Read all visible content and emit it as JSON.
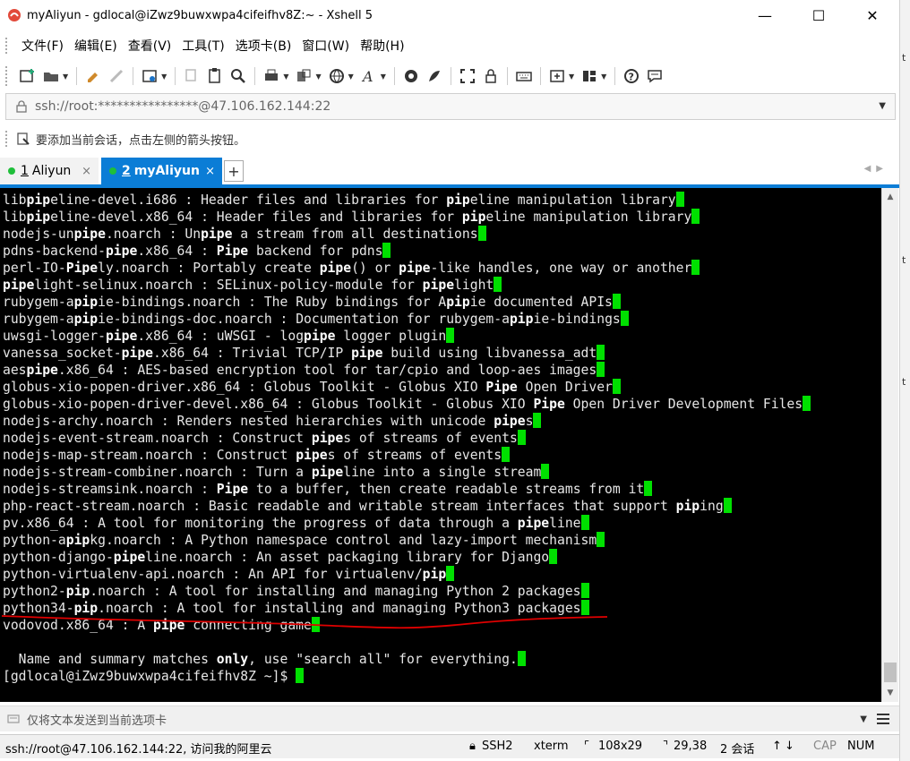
{
  "window": {
    "title": "myAliyun - gdlocal@iZwz9buwxwpa4cifeifhv8Z:~ - Xshell 5",
    "minimize": "—",
    "maximize": "☐",
    "close": "✕"
  },
  "menu": [
    "文件(F)",
    "编辑(E)",
    "查看(V)",
    "工具(T)",
    "选项卡(B)",
    "窗口(W)",
    "帮助(H)"
  ],
  "address": {
    "value": "ssh://root:****************@47.106.162.144:22"
  },
  "hint": {
    "text": "要添加当前会话，点击左侧的箭头按钮。"
  },
  "tabs": [
    {
      "num": "1",
      "label": "Aliyun",
      "close": "×",
      "active": false
    },
    {
      "num": "2",
      "label": "myAliyun",
      "close": "×",
      "active": true
    }
  ],
  "tab_add": "+",
  "terminal": {
    "lines": [
      [
        [
          "libpipeline-devel.i686 : Header files and libraries for ",
          ""
        ]
      ],
      [
        [
          "lib",
          ""
        ],
        [
          "pip",
          "b"
        ],
        [
          "eline-devel.i686 : Header files and libraries for ",
          ""
        ],
        [
          "pip",
          "b"
        ],
        [
          "eline manipulation library",
          ""
        ]
      ],
      [
        [
          "lib",
          ""
        ],
        [
          "pip",
          "b"
        ],
        [
          "eline-devel.x86_64 : Header files and libraries for ",
          ""
        ],
        [
          "pip",
          "b"
        ],
        [
          "eline manipulation library",
          ""
        ]
      ],
      [
        [
          "nodejs-un",
          ""
        ],
        [
          "pipe",
          "b"
        ],
        [
          ".noarch : Un",
          ""
        ],
        [
          "pipe",
          "b"
        ],
        [
          " a stream from all destinations",
          ""
        ]
      ],
      [
        [
          "pdns-backend-",
          ""
        ],
        [
          "pipe",
          "b"
        ],
        [
          ".x86_64 : ",
          ""
        ],
        [
          "Pipe",
          "b"
        ],
        [
          " backend for pdns",
          ""
        ]
      ],
      [
        [
          "perl-IO-",
          ""
        ],
        [
          "Pipe",
          "b"
        ],
        [
          "ly.noarch : Portably create ",
          ""
        ],
        [
          "pipe",
          "b"
        ],
        [
          "() or ",
          ""
        ],
        [
          "pipe",
          "b"
        ],
        [
          "-like handles, one way or another",
          ""
        ]
      ],
      [
        [
          "pipe",
          "b"
        ],
        [
          "light-selinux.noarch : SELinux-policy-module for ",
          ""
        ],
        [
          "pipe",
          "b"
        ],
        [
          "light",
          ""
        ]
      ],
      [
        [
          "rubygem-a",
          ""
        ],
        [
          "pip",
          "b"
        ],
        [
          "ie-bindings.noarch : The Ruby bindings for A",
          ""
        ],
        [
          "pip",
          "b"
        ],
        [
          "ie documented APIs",
          ""
        ]
      ],
      [
        [
          "rubygem-a",
          ""
        ],
        [
          "pip",
          "b"
        ],
        [
          "ie-bindings-doc.noarch : Documentation for rubygem-a",
          ""
        ],
        [
          "pip",
          "b"
        ],
        [
          "ie-bindings",
          ""
        ]
      ],
      [
        [
          "uwsgi-logger-",
          ""
        ],
        [
          "pipe",
          "b"
        ],
        [
          ".x86_64 : uWSGI - log",
          ""
        ],
        [
          "pipe",
          "b"
        ],
        [
          " logger plugin",
          ""
        ]
      ],
      [
        [
          "vanessa_socket-",
          ""
        ],
        [
          "pipe",
          "b"
        ],
        [
          ".x86_64 : Trivial TCP/IP ",
          ""
        ],
        [
          "pipe",
          "b"
        ],
        [
          " build using libvanessa_adt",
          ""
        ]
      ],
      [
        [
          "aes",
          ""
        ],
        [
          "pipe",
          "b"
        ],
        [
          ".x86_64 : AES-based encryption tool for tar/cpio and loop-aes images",
          ""
        ]
      ],
      [
        [
          "globus-xio-popen-driver.x86_64 : Globus Toolkit - Globus XIO ",
          ""
        ],
        [
          "Pipe",
          "b"
        ],
        [
          " Open Driver",
          ""
        ]
      ],
      [
        [
          "globus-xio-popen-driver-devel.x86_64 : Globus Toolkit - Globus XIO ",
          ""
        ],
        [
          "Pipe",
          "b"
        ],
        [
          " Open Driver Development Files",
          ""
        ]
      ],
      [
        [
          "nodejs-archy.noarch : Renders nested hierarchies with unicode ",
          ""
        ],
        [
          "pipe",
          "b"
        ],
        [
          "s",
          ""
        ]
      ],
      [
        [
          "nodejs-event-stream.noarch : Construct ",
          ""
        ],
        [
          "pipe",
          "b"
        ],
        [
          "s of streams of events",
          ""
        ]
      ],
      [
        [
          "nodejs-map-stream.noarch : Construct ",
          ""
        ],
        [
          "pipe",
          "b"
        ],
        [
          "s of streams of events",
          ""
        ]
      ],
      [
        [
          "nodejs-stream-combiner.noarch : Turn a ",
          ""
        ],
        [
          "pipe",
          "b"
        ],
        [
          "line into a single stream",
          ""
        ]
      ],
      [
        [
          "nodejs-streamsink.noarch : ",
          ""
        ],
        [
          "Pipe",
          "b"
        ],
        [
          " to a buffer, then create readable streams from it",
          ""
        ]
      ],
      [
        [
          "php-react-stream.noarch : Basic readable and writable stream interfaces that support ",
          ""
        ],
        [
          "pip",
          "b"
        ],
        [
          "ing",
          ""
        ]
      ],
      [
        [
          "pv.x86_64 : A tool for monitoring the progress of data through a ",
          ""
        ],
        [
          "pipe",
          "b"
        ],
        [
          "line",
          ""
        ]
      ],
      [
        [
          "python-a",
          ""
        ],
        [
          "pip",
          "b"
        ],
        [
          "kg.noarch : A Python namespace control and lazy-import mechanism",
          ""
        ]
      ],
      [
        [
          "python-django-",
          ""
        ],
        [
          "pipe",
          "b"
        ],
        [
          "line.noarch : An asset packaging library for Django",
          ""
        ]
      ],
      [
        [
          "python-virtualenv-api.noarch : An API for virtualenv/",
          ""
        ],
        [
          "pip",
          "b"
        ]
      ],
      [
        [
          "python2-",
          ""
        ],
        [
          "pip",
          "b"
        ],
        [
          ".noarch : A tool for installing and managing Python 2 packages",
          ""
        ]
      ],
      [
        [
          "python34-",
          ""
        ],
        [
          "pip",
          "b"
        ],
        [
          ".noarch : A tool for installing and managing Python3 packages",
          ""
        ]
      ],
      [
        [
          "vodovod.x86_64 : A ",
          ""
        ],
        [
          "pipe",
          "b"
        ],
        [
          " connecting game",
          ""
        ]
      ],
      [
        [
          "",
          ""
        ]
      ],
      [
        [
          "  Name and summary matches ",
          ""
        ],
        [
          "only",
          "b"
        ],
        [
          ", use \"search all\" for everything.",
          ""
        ]
      ],
      [
        [
          "[gdlocal@iZwz9buwxwpa4cifeifhv8Z ~]$ ",
          ""
        ]
      ]
    ]
  },
  "sendbar": {
    "text": "仅将文本发送到当前选项卡"
  },
  "status": {
    "connection": "ssh://root@47.106.162.144:22, 访问我的阿里云",
    "protocol": "SSH2",
    "term": "xterm",
    "size": "108x29",
    "position": "29,38",
    "sessions": "2 会话",
    "cap": "CAP",
    "num": "NUM"
  },
  "right_edge_chars": [
    "t",
    "t",
    "t"
  ]
}
